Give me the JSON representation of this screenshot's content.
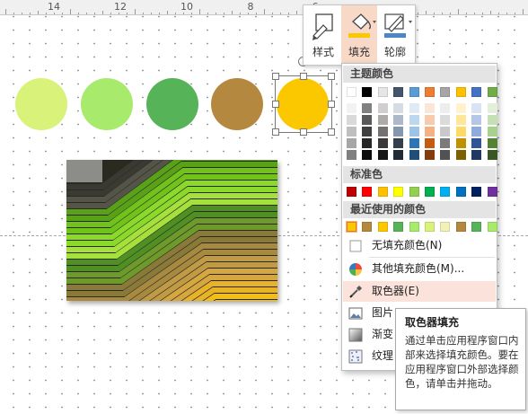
{
  "ruler": {
    "numbers": [
      "14",
      "12",
      "10",
      "8",
      "6"
    ]
  },
  "shapes": {
    "colors": [
      "#d8f27a",
      "#a8ea6c",
      "#57b357",
      "#b4883e",
      "#fbc800"
    ]
  },
  "mini_toolbar": {
    "style_label": "样式",
    "fill_label": "填充",
    "outline_label": "轮廓",
    "fill_accent": "#fbc800",
    "outline_accent": "#4a86c8"
  },
  "fill_menu": {
    "theme_colors_title": "主题颜色",
    "theme_colors": [
      "#ffffff",
      "#000000",
      "#e7e6e6",
      "#44546a",
      "#5b9bd5",
      "#ed7d31",
      "#a5a5a5",
      "#ffc000",
      "#4472c4",
      "#70ad47"
    ],
    "theme_shades": [
      [
        "#f2f2f2",
        "#d9d9d9",
        "#bfbfbf",
        "#a6a6a6",
        "#808080"
      ],
      [
        "#808080",
        "#595959",
        "#404040",
        "#262626",
        "#0d0d0d"
      ],
      [
        "#d0cece",
        "#aeaaaa",
        "#757171",
        "#3a3838",
        "#171616"
      ],
      [
        "#d6dce4",
        "#adb9ca",
        "#8497b0",
        "#333f4f",
        "#222a35"
      ],
      [
        "#deebf7",
        "#bdd7ee",
        "#9dc3e6",
        "#2e75b6",
        "#1f4e79"
      ],
      [
        "#fbe5d6",
        "#f8cbad",
        "#f4b183",
        "#c55a11",
        "#843c0c"
      ],
      [
        "#ededed",
        "#dbdbdb",
        "#c9c9c9",
        "#7b7b7b",
        "#525252"
      ],
      [
        "#fff2cc",
        "#ffe699",
        "#ffd966",
        "#bf9000",
        "#7f6000"
      ],
      [
        "#dae3f3",
        "#b4c7e7",
        "#8faadc",
        "#2f5597",
        "#203864"
      ],
      [
        "#e2f0d9",
        "#c5e0b4",
        "#a9d18e",
        "#548235",
        "#385723"
      ]
    ],
    "standard_colors_title": "标准色",
    "standard_colors": [
      "#c00000",
      "#ff0000",
      "#ffc000",
      "#ffff00",
      "#92d050",
      "#00b050",
      "#00b0f0",
      "#0070c0",
      "#002060",
      "#7030a0"
    ],
    "recent_colors_title": "最近使用的颜色",
    "recent_colors": [
      "#fbc800",
      "#b4883e",
      "#fbc800",
      "#57b357",
      "#a8ea6c",
      "#d8f27a",
      "#f1f1b8",
      "#b4883e",
      "#57b357",
      "#a8ea6c"
    ],
    "no_fill_label": "无填充颜色(N)",
    "more_colors_label": "其他填充颜色(M)...",
    "eyedropper_label": "取色器(E)",
    "picture_label": "图片",
    "gradient_label": "渐变",
    "texture_label": "纹理"
  },
  "tooltip": {
    "title": "取色器填充",
    "description": "通过单击应用程序窗口内部来选择填充颜色。要在应用程序窗口外部选择颜色，请单击并拖动。"
  }
}
